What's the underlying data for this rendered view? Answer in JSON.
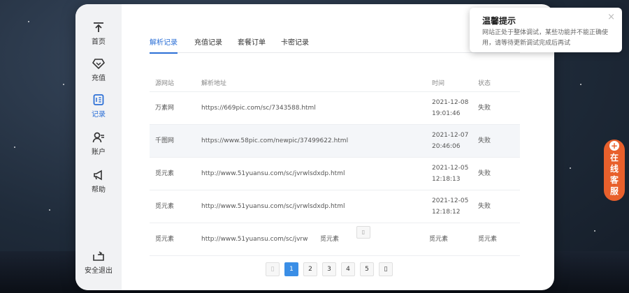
{
  "sidebar": {
    "items": [
      {
        "label": "首页",
        "icon": "upload-home-icon"
      },
      {
        "label": "充值",
        "icon": "diamond-icon"
      },
      {
        "label": "记录",
        "icon": "document-icon"
      },
      {
        "label": "账户",
        "icon": "user-icon"
      },
      {
        "label": "帮助",
        "icon": "megaphone-icon"
      }
    ],
    "logout_label": "安全退出",
    "active_index": 2,
    "accent_color": "#2b6fd6"
  },
  "tabs": [
    "解析记录",
    "充值记录",
    "套餐订单",
    "卡密记录"
  ],
  "table": {
    "headers": [
      "源网站",
      "解析地址",
      "时间",
      "状态"
    ],
    "rows": [
      {
        "site": "万素网",
        "url": "https://669pic.com/sc/7343588.html",
        "date": "2021-12-08",
        "time": "19:01:46",
        "status": "失败"
      },
      {
        "site": "千图网",
        "url": "https://www.58pic.com/newpic/37499622.html",
        "date": "2021-12-07",
        "time": "20:46:06",
        "status": "失败"
      },
      {
        "site": "觅元素",
        "url": "http://www.51yuansu.com/sc/jvrwlsdxdp.html",
        "date": "2021-12-05",
        "time": "12:18:13",
        "status": "失败"
      },
      {
        "site": "觅元素",
        "url": "http://www.51yuansu.com/sc/jvrwlsdxdp.html",
        "date": "2021-12-05",
        "time": "12:18:12",
        "status": "失败"
      }
    ],
    "partial_row": {
      "site": "觅元素",
      "url_fragment": "http://www.51yuansu.com/sc/jvrw",
      "mid_text": "觅元素",
      "time_col": "觅元素",
      "status_col": "觅元素",
      "button_glyph": "▯"
    }
  },
  "pagination": {
    "prev": "▯",
    "pages": [
      "1",
      "2",
      "3",
      "4",
      "5"
    ],
    "next": "▯",
    "active_page": "1"
  },
  "notice": {
    "title": "温馨提示",
    "body": "网站正处于整体调试，某些功能并不能正确使用，请等待更新调试完成后再试",
    "close": "×"
  },
  "customer_service": {
    "plus": "+",
    "label": "在线客服",
    "color": "#e8602c"
  }
}
